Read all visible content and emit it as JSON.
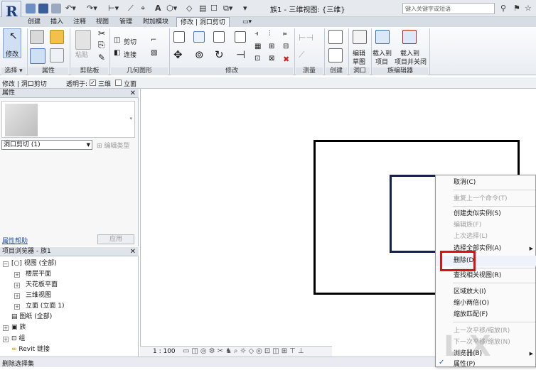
{
  "titlebar": {
    "doc_title": "族1 - 三维视图: {三维}",
    "search_placeholder": "键入关键字或短语"
  },
  "tabs": [
    "创建",
    "插入",
    "注释",
    "视图",
    "管理",
    "附加模块",
    "修改 | 洞口剪切"
  ],
  "ribbon": {
    "modify_label": "修改",
    "paste_label": "粘贴",
    "cut_label": "剪切",
    "join_label": "连接",
    "edit_sketch_label1": "编辑",
    "edit_sketch_label2": "草图",
    "load_project_label1": "载入到",
    "load_project_label2": "项目",
    "load_close_label1": "载入到",
    "load_close_label2": "项目并关闭",
    "panels": [
      "选择 ▾",
      "属性",
      "剪贴板",
      "几何图形",
      "修改",
      "测量",
      "创建",
      "洞口",
      "族编辑器"
    ]
  },
  "optbar": {
    "context": "修改 | 洞口剪切",
    "transparent_label": "透明于:",
    "threeD_label": "三维",
    "elevation_label": "立面"
  },
  "properties": {
    "title": "属性",
    "type_selector": "洞口剪切 (1)",
    "edit_type": "编辑类型",
    "help_link": "属性帮助",
    "apply": "应用"
  },
  "browser": {
    "title": "项目浏览器 - 族1",
    "items": [
      {
        "label": "视图 (全部)"
      },
      {
        "label": "楼层平面"
      },
      {
        "label": "天花板平面"
      },
      {
        "label": "三维视图"
      },
      {
        "label": "立面 (立面 1)"
      },
      {
        "label": "图纸 (全部)"
      },
      {
        "label": "族"
      },
      {
        "label": "组"
      },
      {
        "label": "Revit 链接"
      }
    ]
  },
  "viewbar": {
    "scale": "1 : 100"
  },
  "status": {
    "text": "删除选择集"
  },
  "context_menu": {
    "items": [
      {
        "label": "取消(C)"
      },
      {
        "label": "重复上一个命令(T)"
      },
      {
        "label": "创建类似实例(S)"
      },
      {
        "label": "编辑族(F)"
      },
      {
        "label": "上次选择(L)"
      },
      {
        "label": "选择全部实例(A)"
      },
      {
        "label": "删除(D)"
      },
      {
        "label": "查找相关视图(R)"
      },
      {
        "label": "区域放大(I)"
      },
      {
        "label": "缩小两倍(O)"
      },
      {
        "label": "缩放匹配(F)"
      },
      {
        "label": "上一次平移/缩放(R)"
      },
      {
        "label": "下一次平移/缩放(N)"
      },
      {
        "label": "浏览器(B)"
      },
      {
        "label": "属性(P)"
      }
    ]
  },
  "colors": {
    "highlight": "#e01010",
    "accent": "#1c3e7a"
  }
}
